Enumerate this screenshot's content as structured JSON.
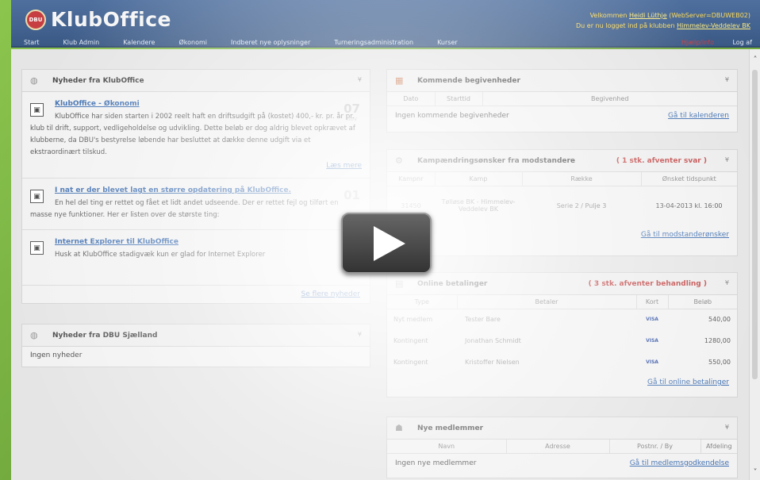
{
  "header": {
    "logo_badge": "DBU",
    "logo_text": "KlubOffice",
    "welcome_prefix": "Velkommen ",
    "user_name": "Heidi Lüthje",
    "server": "(WebServer=DBUWEB02)",
    "club_prefix": "Du er nu logget ind på klubben ",
    "club_name": "Himmelev-Veddelev BK"
  },
  "nav": {
    "items": [
      "Start",
      "Klub Admin",
      "Kalendere",
      "Økonomi",
      "Indberet nye oplysninger",
      "Turneringsadministration",
      "Kurser"
    ],
    "red_link": "Hjælp/info",
    "logout": "Log af"
  },
  "news_klub": {
    "title": "Nyheder fra KlubOffice",
    "items": [
      {
        "title": "KlubOffice - Økonomi",
        "text": "KlubOffice har siden starten i 2002 reelt haft en driftsudgift på (kostet) 400,- kr. pr. år pr. klub til drift, support, vedligeholdelse og udvikling. Dette beløb er dog aldrig blevet opkrævet af klubberne, da DBU's bestyrelse løbende har besluttet at dække denne udgift via et ekstraordinært tilskud.",
        "date_day": "07",
        "date_month": "nov",
        "more": "Læs mere"
      },
      {
        "title": "I nat er der blevet lagt en større opdatering på KlubOffice.",
        "text": "En hel del ting er rettet og fået et lidt andet udseende. Der er rettet fejl og tilført en masse nye funktioner. Her er listen over de største ting:",
        "date_day": "01",
        "date_month": ""
      },
      {
        "title": "Internet Explorer til KlubOffice",
        "text": "Husk at KlubOffice stadigvæk kun er glad for Internet Explorer"
      }
    ],
    "all_link": "Se flere nyheder"
  },
  "news_dbu": {
    "title": "Nyheder fra DBU Sjælland",
    "empty": "Ingen nyheder"
  },
  "events": {
    "title": "Kommende begivenheder",
    "columns": [
      "Dato",
      "Starttid",
      "Begivenhed"
    ],
    "empty": "Ingen kommende begivenheder",
    "link": "Gå til kalenderen"
  },
  "opponent": {
    "title": "Kampændringsønsker fra modstandere",
    "alert": "( 1 stk. afventer svar )",
    "columns": [
      "Kampnr",
      "Kamp",
      "Række",
      "Ønsket tidspunkt"
    ],
    "rows": [
      {
        "match_no": "31450",
        "match": "Tølløse BK - Himmelev-Veddelev BK",
        "series": "Serie 2 / Pulje 3",
        "time": "13-04-2013 kl. 16:00"
      }
    ],
    "link": "Gå til modstanderønsker"
  },
  "payments": {
    "title": "Online betalinger",
    "alert": "( 3 stk. afventer behandling )",
    "columns": [
      "Type",
      "Betaler",
      "Kort",
      "Beløb"
    ],
    "rows": [
      {
        "type": "Nyt medlem",
        "payer": "Tester Bare",
        "card": "VISA",
        "amount": "540,00"
      },
      {
        "type": "Kontingent",
        "payer": "Jonathan Schmidt",
        "card": "VISA",
        "amount": "1280,00"
      },
      {
        "type": "Kontingent",
        "payer": "Kristoffer Nielsen",
        "card": "VISA",
        "amount": "550,00"
      }
    ],
    "link": "Gå til online betalinger"
  },
  "members": {
    "title": "Nye medlemmer",
    "columns": [
      "Navn",
      "Adresse",
      "Postnr. / By",
      "Afdeling"
    ],
    "empty": "Ingen nye medlemmer",
    "link": "Gå til medlemsgodkendelse"
  }
}
